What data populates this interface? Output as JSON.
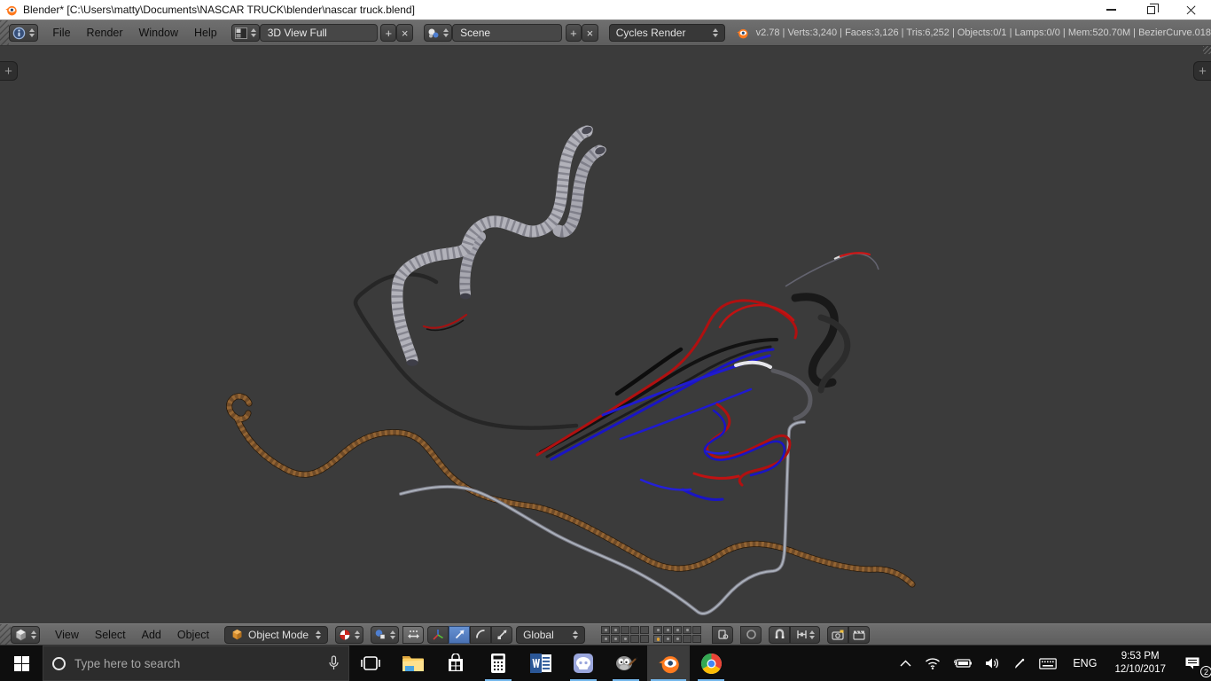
{
  "window": {
    "title": "Blender* [C:\\Users\\matty\\Documents\\NASCAR TRUCK\\blender\\nascar truck.blend]"
  },
  "info_header": {
    "menus": [
      "File",
      "Render",
      "Window",
      "Help"
    ],
    "layout_field": "3D View Full",
    "scene_field": "Scene",
    "engine_field": "Cycles Render",
    "add_glyph": "+",
    "close_glyph": "×",
    "stats": "v2.78 | Verts:3,240 | Faces:3,126 | Tris:6,252 | Objects:0/1 | Lamps:0/0 | Mem:520.70M | BezierCurve.018"
  },
  "viewport": {
    "toolshelf_expand_glyph": "+",
    "properties_expand_glyph": "+"
  },
  "view3d_header": {
    "menus": [
      "View",
      "Select",
      "Add",
      "Object"
    ],
    "mode_field": "Object Mode",
    "orientation_field": "Global"
  },
  "taskbar": {
    "search_placeholder": "Type here to search",
    "tray": {
      "language": "ENG",
      "time": "9:53 PM",
      "date": "12/10/2017",
      "notification_count": "2"
    }
  },
  "colors": {
    "accent_blue": "#4a72b4",
    "taskbar_underline": "#76b9ed",
    "blender_orange": "#ff7a1e",
    "active_layer_dot": "#e0a030",
    "viewport_bg": "#3b3b3b"
  }
}
